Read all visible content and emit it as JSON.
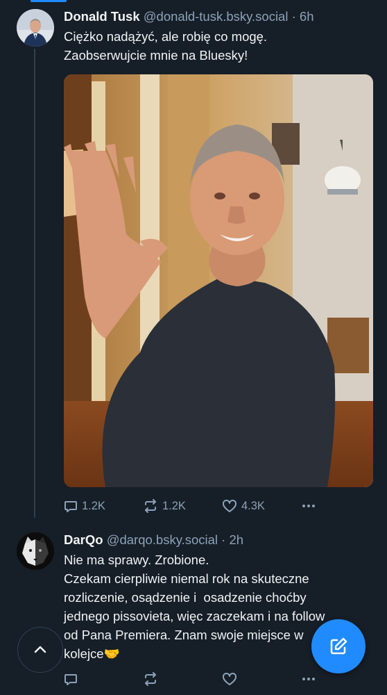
{
  "posts": [
    {
      "author": "Donald Tusk",
      "handle": "@donald-tusk.bsky.social",
      "separator": "·",
      "time": "6h",
      "text_lines": [
        "Ciężko nadążyć, ale robię co mogę.",
        "Zaobserwujcie mnie na Bluesky!"
      ],
      "has_image": true,
      "actions": {
        "replies": "1.2K",
        "reposts": "1.2K",
        "likes": "4.3K"
      },
      "icons": {
        "reply": "reply-icon",
        "repost": "repost-icon",
        "like": "heart-icon",
        "more": "more-icon"
      }
    },
    {
      "author": "DarQo",
      "handle": "@darqo.bsky.social",
      "separator": "·",
      "time": "2h",
      "text_lines": [
        "Nie ma sprawy. Zrobione.",
        "Czekam cierpliwie niemal rok na skuteczne",
        "rozliczenie, osądzenie i  osadzenie choćby",
        "jednego pissovieta, więc zaczekam i na follow",
        "od Pana Premiera. Znam swoje miejsce w",
        "kolejce🤝"
      ],
      "actions": {
        "replies": "",
        "reposts": "",
        "likes": ""
      }
    }
  ],
  "floating": {
    "scroll_top_icon": "chevron-up-icon",
    "compose_icon": "compose-icon"
  },
  "colors": {
    "background": "#161e27",
    "accent": "#208bfe",
    "muted": "#8da2b8",
    "text": "#f1f3f5",
    "thread_line": "#2e4052"
  }
}
